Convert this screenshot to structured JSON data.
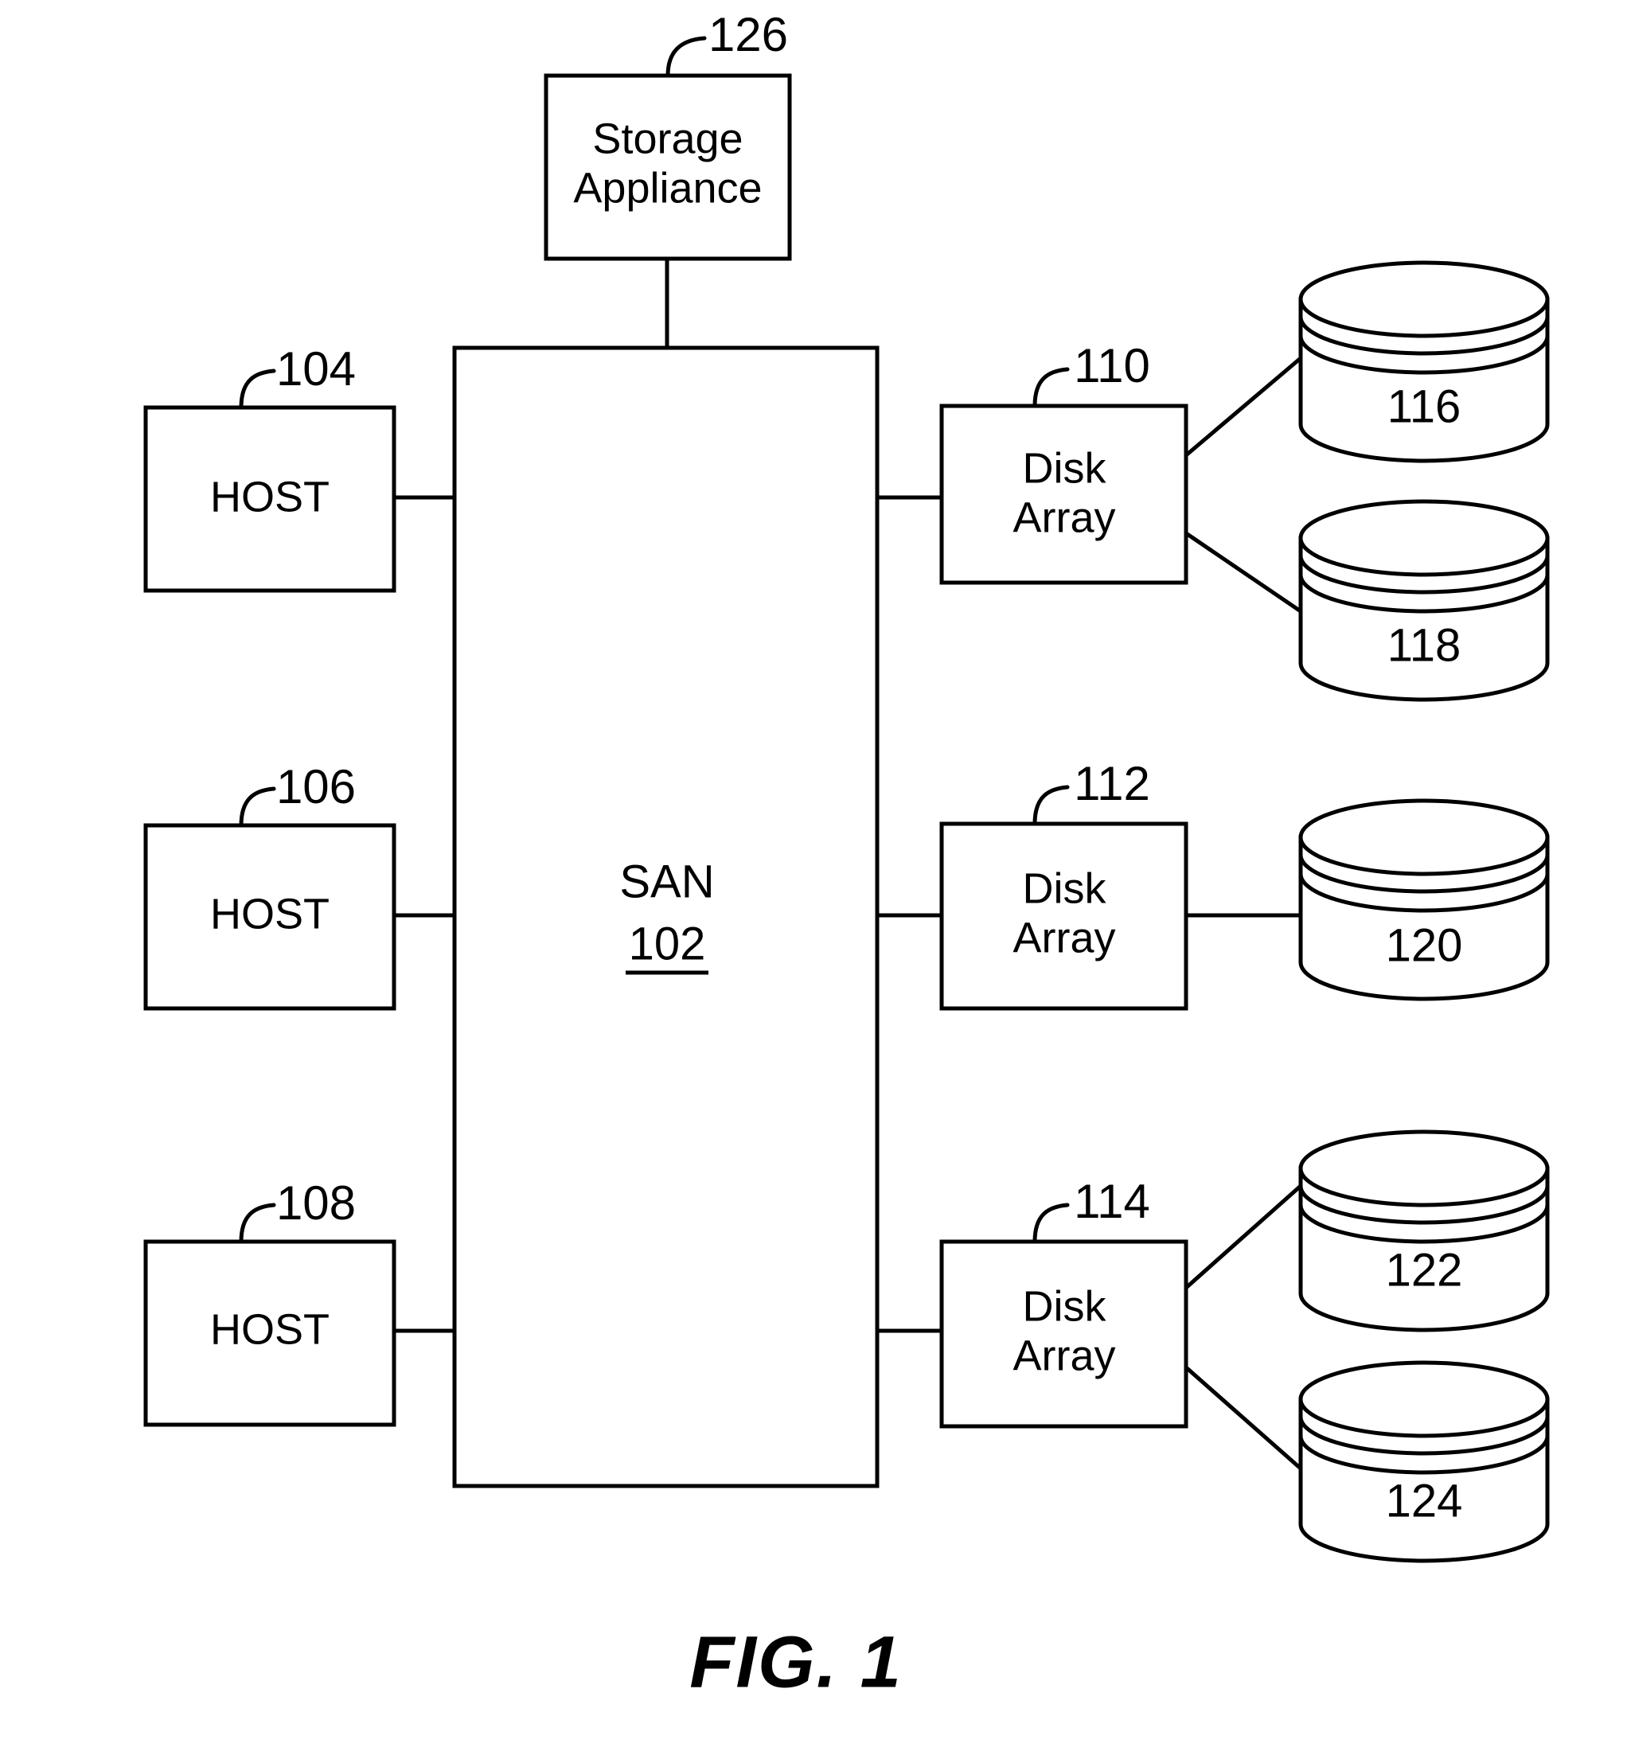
{
  "figure": {
    "caption": "FIG. 1",
    "title": "FIG. 1"
  },
  "network": {
    "label": "SAN",
    "ref": "102"
  },
  "appliance": {
    "line1": "Storage",
    "line2": "Appliance",
    "ref": "126"
  },
  "hosts": [
    {
      "label": "HOST",
      "ref": "104"
    },
    {
      "label": "HOST",
      "ref": "106"
    },
    {
      "label": "HOST",
      "ref": "108"
    }
  ],
  "disk_arrays": [
    {
      "line1": "Disk",
      "line2": "Array",
      "ref": "110"
    },
    {
      "line1": "Disk",
      "line2": "Array",
      "ref": "112"
    },
    {
      "line1": "Disk",
      "line2": "Array",
      "ref": "114"
    }
  ],
  "disks": [
    {
      "ref": "116"
    },
    {
      "ref": "118"
    },
    {
      "ref": "120"
    },
    {
      "ref": "122"
    },
    {
      "ref": "124"
    }
  ],
  "colors": {
    "ink": "#000000",
    "paper": "#ffffff"
  }
}
